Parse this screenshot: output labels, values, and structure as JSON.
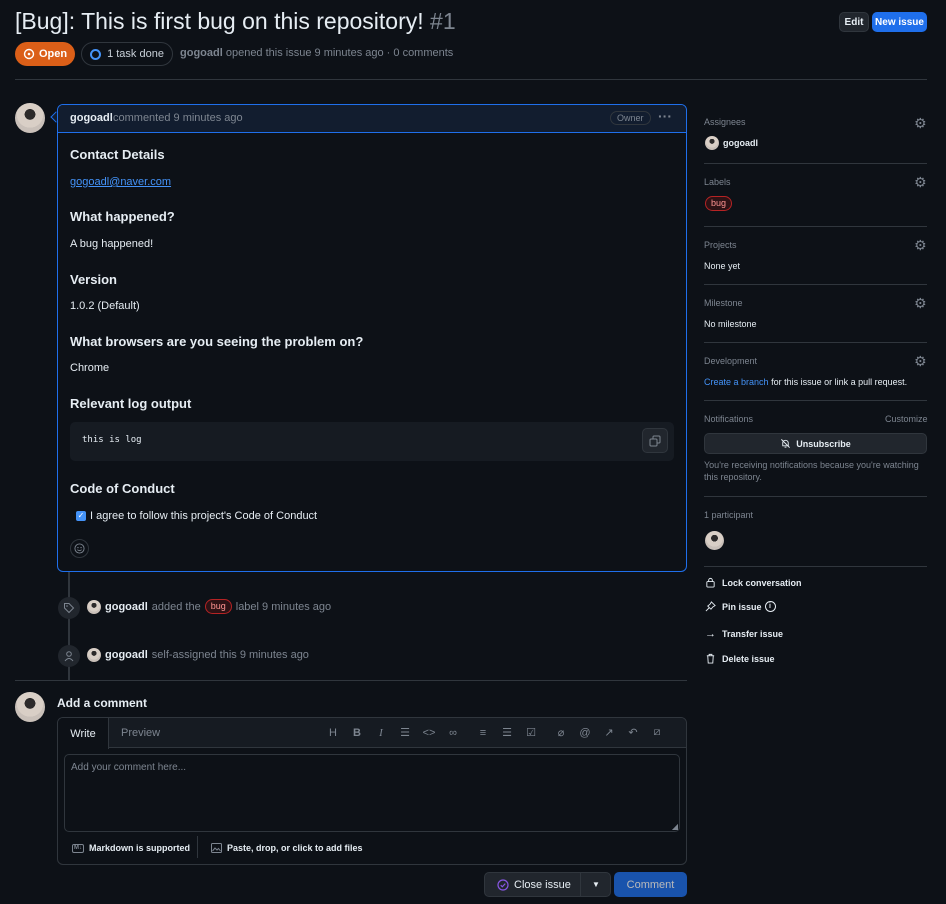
{
  "header": {
    "title": "[Bug]: This is first bug on this repository!",
    "number": "#1",
    "edit_label": "Edit",
    "new_issue_label": "New issue",
    "state_label": "Open",
    "tasks_label": "1 task done",
    "author": "gogoadl",
    "meta_text": "opened this issue 9 minutes ago · 0 comments"
  },
  "comment": {
    "author": "gogoadl",
    "time": "commented 9 minutes ago",
    "role_badge": "Owner",
    "sections": {
      "contact_heading": "Contact Details",
      "contact_value": "gogoadl@naver.com",
      "happened_heading": "What happened?",
      "happened_value": "A bug happened!",
      "version_heading": "Version",
      "version_value": "1.0.2 (Default)",
      "browsers_heading": "What browsers are you seeing the problem on?",
      "browsers_value": "Chrome",
      "log_heading": "Relevant log output",
      "log_value": "this is log",
      "conduct_heading": "Code of Conduct",
      "conduct_value": "I agree to follow this project's Code of Conduct"
    }
  },
  "timeline": [
    {
      "author": "gogoadl",
      "prefix": "added the",
      "label": "bug",
      "suffix": "label 9 minutes ago",
      "icon": "tag-icon"
    },
    {
      "author": "gogoadl",
      "text": "self-assigned this 9 minutes ago",
      "icon": "person-icon"
    }
  ],
  "composer": {
    "heading": "Add a comment",
    "tab_write": "Write",
    "tab_preview": "Preview",
    "placeholder": "Add your comment here...",
    "markdown_note": "Markdown is supported",
    "attach_note": "Paste, drop, or click to add files",
    "close_label": "Close issue",
    "comment_label": "Comment"
  },
  "sidebar": {
    "assignees_title": "Assignees",
    "assignee": "gogoadl",
    "labels_title": "Labels",
    "label": "bug",
    "projects_title": "Projects",
    "projects_value": "None yet",
    "milestone_title": "Milestone",
    "milestone_value": "No milestone",
    "development_title": "Development",
    "development_link": "Create a branch",
    "development_text": "for this issue or link a pull request.",
    "notifications_title": "Notifications",
    "customize": "Customize",
    "unsubscribe": "Unsubscribe",
    "notify_text": "You're receiving notifications because you're watching this repository.",
    "participants": "1 participant",
    "lock": "Lock conversation",
    "pin": "Pin issue",
    "transfer": "Transfer issue",
    "delete": "Delete issue"
  },
  "colors": {
    "accent": "#1f6feb",
    "open_state": "#db5f18",
    "label_bug": "#ff9492",
    "link": "#4493f8"
  }
}
